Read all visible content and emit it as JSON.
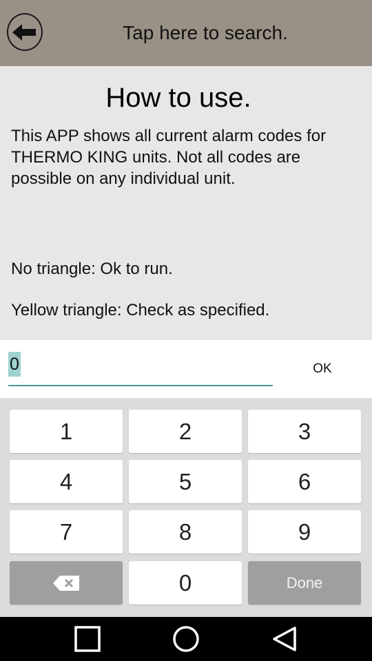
{
  "header": {
    "search_hint": "Tap here to search.",
    "back_icon": "arrow-left-icon"
  },
  "content": {
    "title": "How to use.",
    "paragraph_1": "This APP shows all current alarm codes for THERMO KING units. Not all codes are possible on any individual unit.",
    "paragraph_2": "No triangle: Ok to run.",
    "paragraph_3": "Yellow triangle: Check as specified."
  },
  "input": {
    "value": "0",
    "ok_label": "OK"
  },
  "keypad": {
    "keys": [
      "1",
      "2",
      "3",
      "4",
      "5",
      "6",
      "7",
      "8",
      "9",
      "0"
    ],
    "backspace_icon": "backspace-icon",
    "done_label": "Done"
  },
  "navbar": {
    "icons": [
      "recent-apps-icon",
      "home-icon",
      "back-icon"
    ]
  },
  "colors": {
    "header_bg": "#9a9186",
    "content_bg": "#e7e7e7",
    "accent": "#4a9a95",
    "selection": "#9fd3cf",
    "keypad_bg": "#dcdcdc",
    "action_key": "#9d9fa1"
  }
}
